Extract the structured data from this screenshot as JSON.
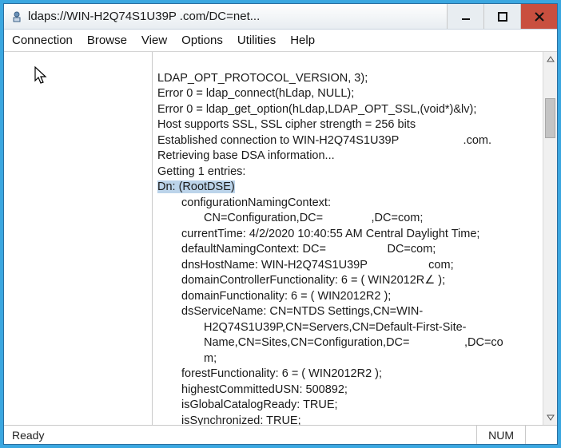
{
  "titlebar": {
    "title": "ldaps://WIN-H2Q74S1U39P                  .com/DC=net..."
  },
  "menu": {
    "connection": "Connection",
    "browse": "Browse",
    "view": "View",
    "options": "Options",
    "utilities": "Utilities",
    "help": "Help"
  },
  "log": {
    "l0": "LDAP_OPT_PROTOCOL_VERSION, 3);",
    "l1": "Error 0 = ldap_connect(hLdap, NULL);",
    "l2": "Error 0 = ldap_get_option(hLdap,LDAP_OPT_SSL,(void*)&lv);",
    "l3": "Host supports SSL, SSL cipher strength = 256 bits",
    "l4": "Established connection to WIN-H2Q74S1U39P                    .com.",
    "l5": "Retrieving base DSA information...",
    "l6": "Getting 1 entries:",
    "l7": "Dn: (RootDSE)",
    "a1": "configurationNamingContext:",
    "a1b": "CN=Configuration,DC=               ,DC=com;",
    "a2": "currentTime: 4/2/2020 10:40:55 AM Central Daylight Time;",
    "a3": "defaultNamingContext: DC=                   DC=com;",
    "a4": "dnsHostName: WIN-H2Q74S1U39P                   com;",
    "a5": "domainControllerFunctionality: 6 = ( WIN2012R∠ );",
    "a6": "domainFunctionality: 6 = ( WIN2012R2 );",
    "a7": "dsServiceName: CN=NTDS Settings,CN=WIN-",
    "a7b": "H2Q74S1U39P,CN=Servers,CN=Default-First-Site-",
    "a7c": "Name,CN=Sites,CN=Configuration,DC=                 ,DC=co",
    "a7d": "m;",
    "a8": "forestFunctionality: 6 = ( WIN2012R2 );",
    "a9": "highestCommittedUSN: 500892;",
    "a10": "isGlobalCatalogReady: TRUE;",
    "a11": "isSynchronized: TRUE;"
  },
  "status": {
    "ready": "Ready",
    "num": "NUM"
  }
}
